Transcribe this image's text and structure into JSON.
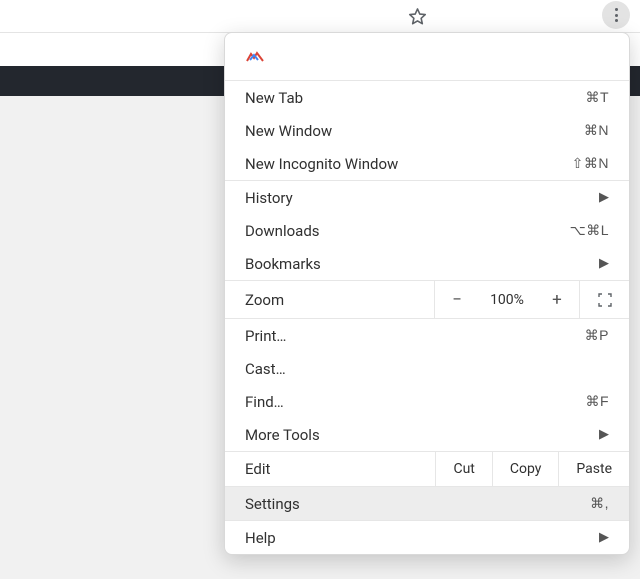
{
  "menu": {
    "new_tab": {
      "label": "New Tab",
      "shortcut": "⌘T"
    },
    "new_window": {
      "label": "New Window",
      "shortcut": "⌘N"
    },
    "new_incognito": {
      "label": "New Incognito Window",
      "shortcut": "⇧⌘N"
    },
    "history": {
      "label": "History"
    },
    "downloads": {
      "label": "Downloads",
      "shortcut": "⌥⌘L"
    },
    "bookmarks": {
      "label": "Bookmarks"
    },
    "zoom": {
      "label": "Zoom",
      "value": "100%",
      "minus": "−",
      "plus": "+"
    },
    "print": {
      "label": "Print…",
      "shortcut": "⌘P"
    },
    "cast": {
      "label": "Cast…"
    },
    "find": {
      "label": "Find…",
      "shortcut": "⌘F"
    },
    "more_tools": {
      "label": "More Tools"
    },
    "edit": {
      "label": "Edit",
      "cut": "Cut",
      "copy": "Copy",
      "paste": "Paste"
    },
    "settings": {
      "label": "Settings",
      "shortcut": "⌘,"
    },
    "help": {
      "label": "Help"
    }
  }
}
